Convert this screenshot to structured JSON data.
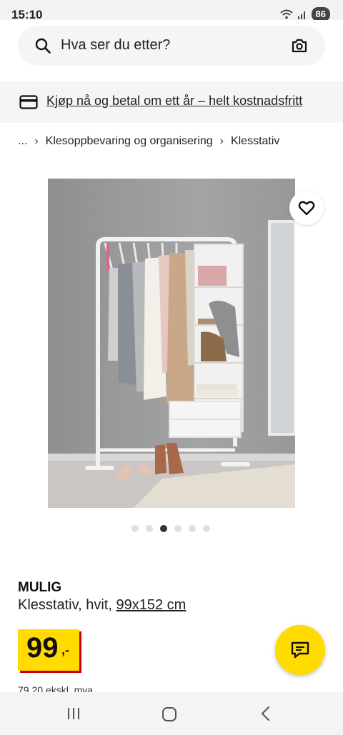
{
  "status_bar": {
    "time": "15:10",
    "battery": "86",
    "icons": [
      "wifi-icon",
      "signal-icon",
      "battery-icon"
    ]
  },
  "search": {
    "placeholder": "Hva ser du etter?",
    "icons": [
      "search-icon",
      "camera-icon"
    ]
  },
  "promo": {
    "text": "Kjøp nå og betal om ett år – helt kostnadsfritt",
    "icon": "credit-card-icon"
  },
  "breadcrumb": {
    "items": [
      "...",
      "Klesoppbevaring og organisering",
      "Klesstativ"
    ],
    "separator": "›"
  },
  "gallery": {
    "image_count": 6,
    "active_index": 2,
    "favorite_icon": "heart-outline-icon"
  },
  "product": {
    "name": "MULIG",
    "description": "Klesstativ, hvit, ",
    "size": "99x152 cm",
    "price": "99",
    "price_suffix": ",-",
    "vat_note": "79,20 ekskl. mva"
  },
  "chat": {
    "icon": "chat-bubble-icon"
  },
  "nav_bar": {
    "icons": [
      "recent-apps-icon",
      "home-icon",
      "back-icon"
    ]
  },
  "colors": {
    "brand_yellow": "#ffdb00",
    "price_shadow_red": "#cc0008",
    "surface_gray": "#f5f5f5"
  }
}
